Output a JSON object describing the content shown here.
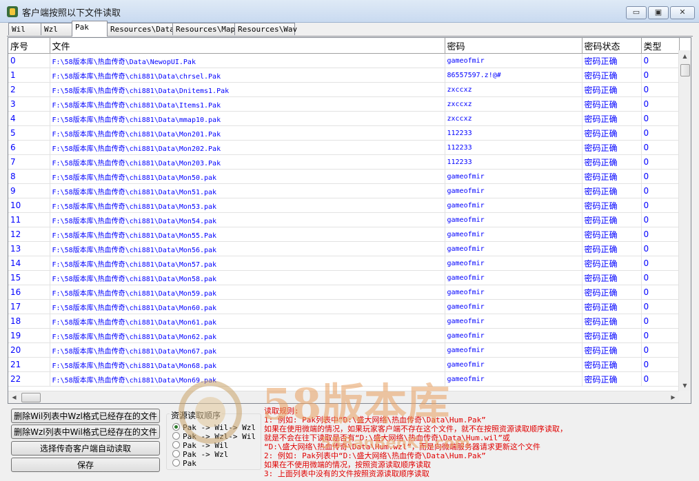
{
  "window": {
    "title": "客户端按照以下文件读取",
    "minimize_label": "▭",
    "maximize_label": "▣",
    "close_label": "✕"
  },
  "tabs": [
    "Wil",
    "Wzl",
    "Pak",
    "Resources\\Data",
    "Resources\\Map",
    "Resources\\Wav"
  ],
  "table": {
    "headers": [
      "序号",
      "文件",
      "密码",
      "密码状态",
      "类型"
    ],
    "rows": [
      [
        "0",
        "F:\\58版本库\\热血传奇\\Data\\NewopUI.Pak",
        "gameofmir",
        "密码正确",
        "0"
      ],
      [
        "1",
        "F:\\58版本库\\热血传奇\\chi881\\Data\\chrsel.Pak",
        "86557597.z!@#",
        "密码正确",
        "0"
      ],
      [
        "2",
        "F:\\58版本库\\热血传奇\\chi881\\Data\\Dnitems1.Pak",
        "zxccxz",
        "密码正确",
        "0"
      ],
      [
        "3",
        "F:\\58版本库\\热血传奇\\chi881\\Data\\Items1.Pak",
        "zxccxz",
        "密码正确",
        "0"
      ],
      [
        "4",
        "F:\\58版本库\\热血传奇\\chi881\\Data\\mmap10.pak",
        "zxccxz",
        "密码正确",
        "0"
      ],
      [
        "5",
        "F:\\58版本库\\热血传奇\\chi881\\Data\\Mon201.Pak",
        "112233",
        "密码正确",
        "0"
      ],
      [
        "6",
        "F:\\58版本库\\热血传奇\\chi881\\Data\\Mon202.Pak",
        "112233",
        "密码正确",
        "0"
      ],
      [
        "7",
        "F:\\58版本库\\热血传奇\\chi881\\Data\\Mon203.Pak",
        "112233",
        "密码正确",
        "0"
      ],
      [
        "8",
        "F:\\58版本库\\热血传奇\\chi881\\Data\\Mon50.pak",
        "gameofmir",
        "密码正确",
        "0"
      ],
      [
        "9",
        "F:\\58版本库\\热血传奇\\chi881\\Data\\Mon51.pak",
        "gameofmir",
        "密码正确",
        "0"
      ],
      [
        "10",
        "F:\\58版本库\\热血传奇\\chi881\\Data\\Mon53.pak",
        "gameofmir",
        "密码正确",
        "0"
      ],
      [
        "11",
        "F:\\58版本库\\热血传奇\\chi881\\Data\\Mon54.pak",
        "gameofmir",
        "密码正确",
        "0"
      ],
      [
        "12",
        "F:\\58版本库\\热血传奇\\chi881\\Data\\Mon55.Pak",
        "gameofmir",
        "密码正确",
        "0"
      ],
      [
        "13",
        "F:\\58版本库\\热血传奇\\chi881\\Data\\Mon56.pak",
        "gameofmir",
        "密码正确",
        "0"
      ],
      [
        "14",
        "F:\\58版本库\\热血传奇\\chi881\\Data\\Mon57.pak",
        "gameofmir",
        "密码正确",
        "0"
      ],
      [
        "15",
        "F:\\58版本库\\热血传奇\\chi881\\Data\\Mon58.pak",
        "gameofmir",
        "密码正确",
        "0"
      ],
      [
        "16",
        "F:\\58版本库\\热血传奇\\chi881\\Data\\Mon59.pak",
        "gameofmir",
        "密码正确",
        "0"
      ],
      [
        "17",
        "F:\\58版本库\\热血传奇\\chi881\\Data\\Mon60.pak",
        "gameofmir",
        "密码正确",
        "0"
      ],
      [
        "18",
        "F:\\58版本库\\热血传奇\\chi881\\Data\\Mon61.pak",
        "gameofmir",
        "密码正确",
        "0"
      ],
      [
        "19",
        "F:\\58版本库\\热血传奇\\chi881\\Data\\Mon62.pak",
        "gameofmir",
        "密码正确",
        "0"
      ],
      [
        "20",
        "F:\\58版本库\\热血传奇\\chi881\\Data\\Mon67.pak",
        "gameofmir",
        "密码正确",
        "0"
      ],
      [
        "21",
        "F:\\58版本库\\热血传奇\\chi881\\Data\\Mon68.pak",
        "gameofmir",
        "密码正确",
        "0"
      ],
      [
        "22",
        "F:\\58版本库\\热血传奇\\chi881\\Data\\Mon69.pak",
        "gameofmir",
        "密码正确",
        "0"
      ]
    ]
  },
  "buttons": {
    "delete_wil": "删除Wil列表中Wzl格式已经存在的文件",
    "delete_wzl": "删除Wzl列表中Wil格式已经存在的文件",
    "choose_client": "选择传奇客户端自动读取",
    "save": "保存"
  },
  "load_order": {
    "title": "资源读取顺序",
    "options": [
      "Pak -> Wil-> Wzl",
      "Pak -> Wzl-> Wil",
      "Pak -> Wil",
      "Pak -> Wzl",
      "Pak"
    ],
    "selected_index": 0
  },
  "rules": [
    "读取规则:",
    "1: 例如: Pak列表中“D:\\盛大网络\\热血传奇\\Data\\Hum.Pak”",
    "   如果在使用微端的情况，如果玩家客户端不存在这个文件，就不在按照资源读取顺序读取，",
    "   就是不会在往下读取是否有“D:\\盛大网络\\热血传奇\\Data\\Hum.wil”或",
    "   “D:\\盛大网络\\热血传奇\\Data\\Hum.wzl”，而是向微端服务器请求更新这个文件",
    "2: 例如: Pak列表中“D:\\盛大网络\\热血传奇\\Data\\Hum.Pak”",
    "   如果在不使用微端的情况，按照资源读取顺序读取",
    "3: 上面列表中没有的文件按照资源读取顺序读取"
  ],
  "watermark": {
    "text": "58版本库",
    "sub": "58BanBenKu.com"
  },
  "colors": {
    "link_blue": "#0000ff",
    "rule_red": "#e00000"
  }
}
